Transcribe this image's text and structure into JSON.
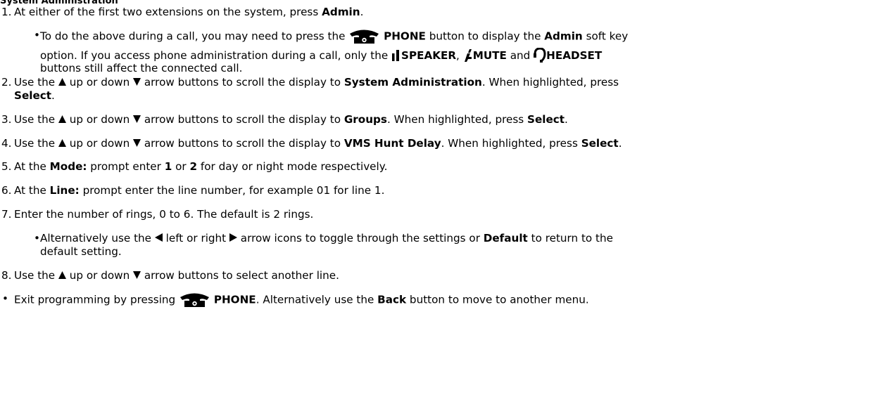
{
  "top_fragment": "System Administration",
  "steps": [
    {
      "num": "1.",
      "pre": "At either of the first two extensions on the system, press ",
      "b1": "Admin",
      "post": "."
    },
    {
      "num": "2.",
      "pre": "Use the ",
      "mid1": " up or down ",
      "mid2": " arrow buttons to scroll the display to ",
      "b1": "System Administration",
      "mid3": ". When highlighted, press",
      "b2": "Select",
      "post": "."
    },
    {
      "num": "3.",
      "pre": "Use the ",
      "mid1": " up or down ",
      "mid2": " arrow buttons to scroll the display to ",
      "b1": "Groups",
      "mid3": ". When highlighted, press ",
      "b2": "Select",
      "post": "."
    },
    {
      "num": "4.",
      "pre": "Use the ",
      "mid1": " up or down ",
      "mid2": " arrow buttons to scroll the display to ",
      "b1": "VMS Hunt Delay",
      "mid3": ". When highlighted, press ",
      "b2": "Select",
      "post": "."
    },
    {
      "num": "5.",
      "pre": "At the ",
      "b1": "Mode:",
      "mid1": " prompt enter ",
      "b2": "1",
      "mid2": " or ",
      "b3": "2",
      "post": " for day or night mode respectively."
    },
    {
      "num": "6.",
      "pre": "At the ",
      "b1": "Line:",
      "post": " prompt enter the line number, for example 01 for line 1."
    },
    {
      "num": "7.",
      "text": "Enter the number of rings, 0 to 6. The default is 2 rings."
    },
    {
      "num": "8.",
      "pre": "Use the ",
      "mid1": " up or down ",
      "post": " arrow buttons to select another line."
    }
  ],
  "bullet1": {
    "l1_pre": "To do the above during a call, you may need to press the ",
    "l1_b1": "PHONE",
    "l1_mid": " button to display the ",
    "l1_b2": "Admin",
    "l1_post": " soft key",
    "l2_pre": "option. If you access phone administration during a call, only the ",
    "l2_b1": "SPEAKER",
    "l2_c1": ", ",
    "l2_b2": "MUTE",
    "l2_and": " and ",
    "l2_b3": "HEADSET",
    "l3": "buttons still affect the connected call."
  },
  "bullet7": {
    "l1_pre": "Alternatively use the ",
    "l1_mid": " left or right ",
    "l1_post": " arrow icons to toggle through the settings or ",
    "l1_b1": "Default",
    "l1_end": " to return to the",
    "l2": "default setting."
  },
  "exit": {
    "pre": "Exit programming by pressing ",
    "b1": "PHONE",
    "mid": ". Alternatively use the ",
    "b2": "Back",
    "post": " button to move to another menu."
  },
  "icons": [
    "phone-icon",
    "speaker-icon",
    "mute-icon",
    "headset-icon",
    "up-arrow-icon",
    "down-arrow-icon",
    "left-arrow-icon",
    "right-arrow-icon"
  ]
}
